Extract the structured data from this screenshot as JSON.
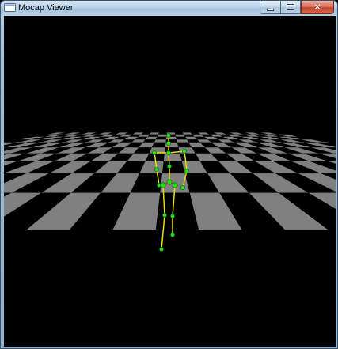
{
  "window": {
    "title": "Mocap Viewer",
    "icon": "app-window-icon"
  },
  "title_controls": {
    "minimize_icon": "minimize-icon",
    "maximize_icon": "maximize-icon",
    "close_icon": "close-icon",
    "close_glyph": "✕"
  },
  "scene": {
    "background_color": "#000000",
    "floor_light_color": "#808080",
    "floor_dark_color": "#000000",
    "skeleton_bone_color": "#e8e000",
    "skeleton_joint_color": "#22dd22",
    "skeleton_highlight_color": "#e02020"
  }
}
